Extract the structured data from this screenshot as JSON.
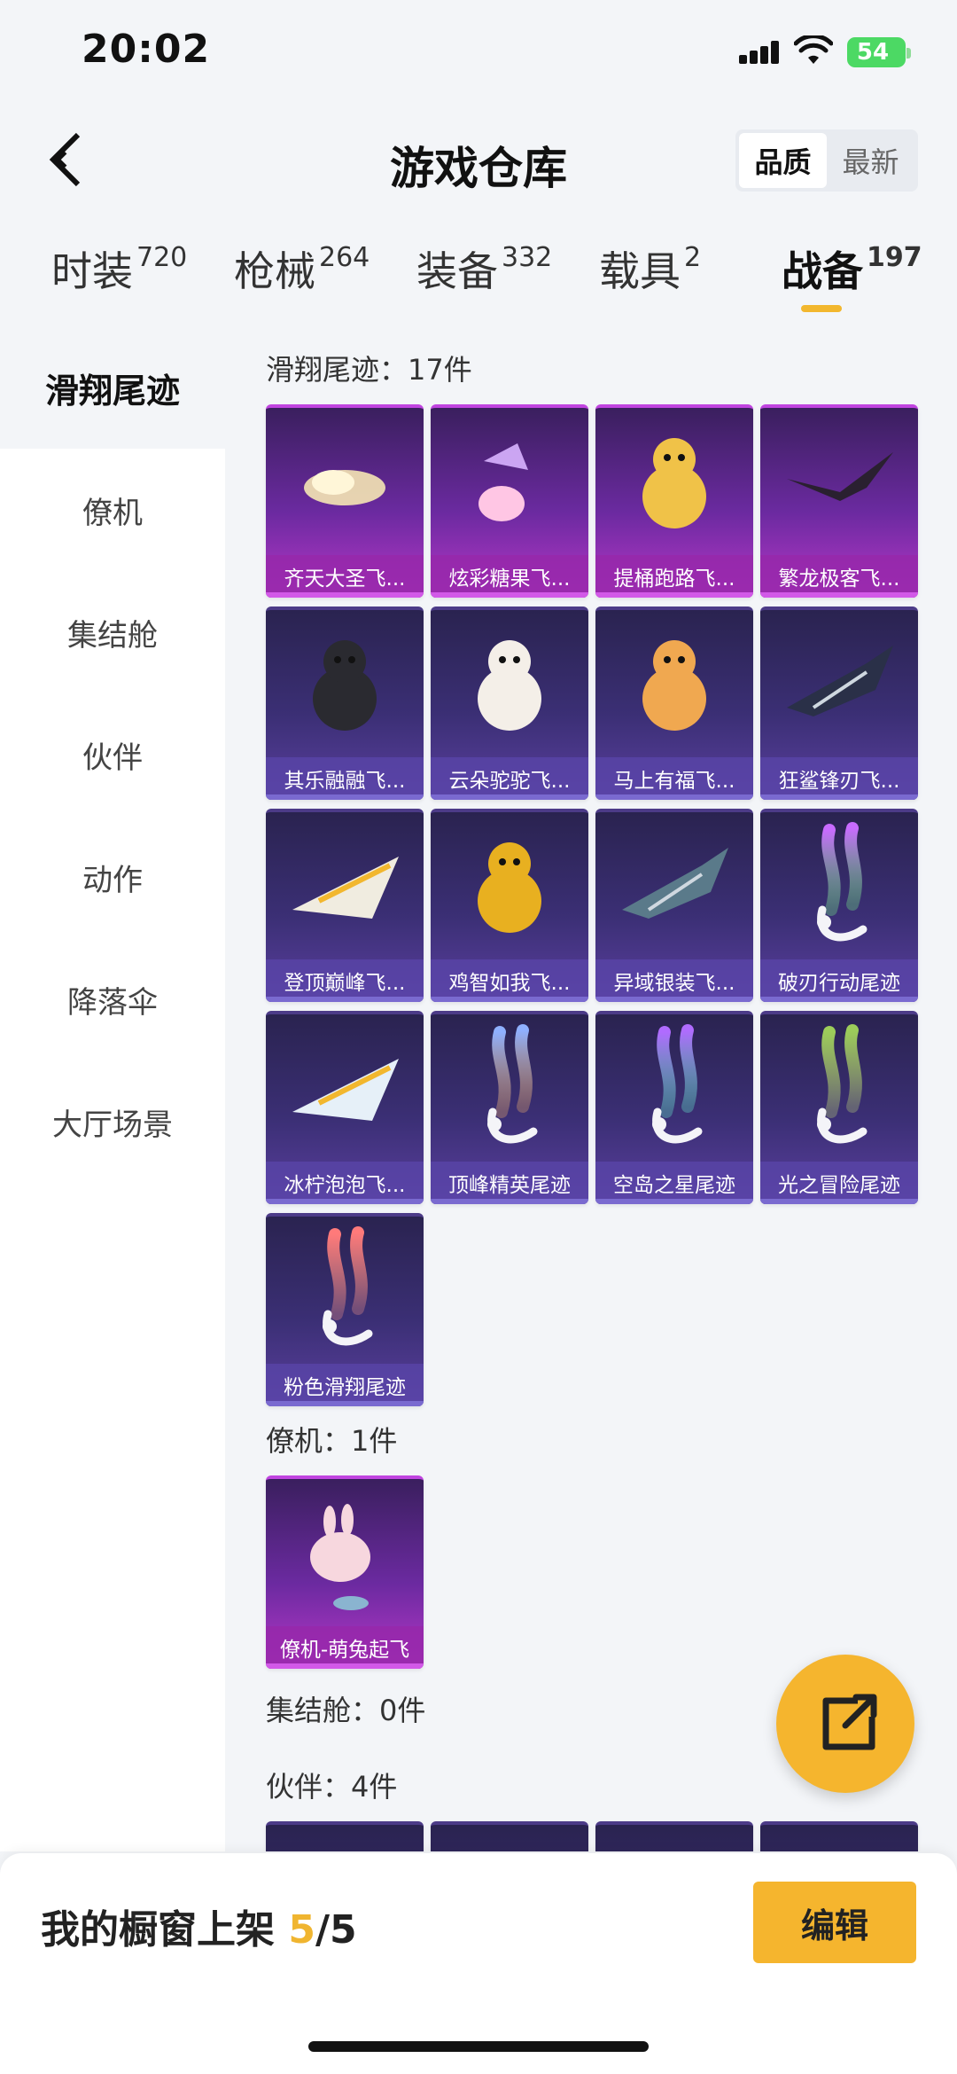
{
  "status_bar": {
    "time": "20:02",
    "battery": "54"
  },
  "header": {
    "title": "游戏仓库",
    "sort_options": [
      {
        "label": "品质",
        "active": true
      },
      {
        "label": "最新",
        "active": false
      }
    ]
  },
  "category_tabs": [
    {
      "label": "时装",
      "count": "720",
      "active": false
    },
    {
      "label": "枪械",
      "count": "264",
      "active": false
    },
    {
      "label": "装备",
      "count": "332",
      "active": false
    },
    {
      "label": "载具",
      "count": "2",
      "active": false
    },
    {
      "label": "战备",
      "count": "197",
      "active": true
    }
  ],
  "sidebar": {
    "items": [
      {
        "label": "滑翔尾迹",
        "active": true
      },
      {
        "label": "僚机",
        "active": false
      },
      {
        "label": "集结舱",
        "active": false
      },
      {
        "label": "伙伴",
        "active": false
      },
      {
        "label": "动作",
        "active": false
      },
      {
        "label": "降落伞",
        "active": false
      },
      {
        "label": "大厅场景",
        "active": false
      }
    ]
  },
  "sections": [
    {
      "title": "滑翔尾迹：17件",
      "items": [
        {
          "name": "齐天大圣飞...",
          "rarity": "legendary",
          "icon": "golden-cloud"
        },
        {
          "name": "炫彩糖果飞...",
          "rarity": "legendary",
          "icon": "candy-wings"
        },
        {
          "name": "提桶跑路飞...",
          "rarity": "legendary",
          "icon": "bee-mascot"
        },
        {
          "name": "繁龙极客飞...",
          "rarity": "legendary",
          "icon": "dragon-glider"
        },
        {
          "name": "其乐融融飞...",
          "rarity": "epic",
          "icon": "penguin-mascot"
        },
        {
          "name": "云朵驼驼飞...",
          "rarity": "epic",
          "icon": "alpaca-mascot"
        },
        {
          "name": "马上有福飞...",
          "rarity": "epic",
          "icon": "horse-mascot"
        },
        {
          "name": "狂鲨锋刃飞...",
          "rarity": "epic",
          "icon": "shark-glider"
        },
        {
          "name": "登顶巅峰飞...",
          "rarity": "epic",
          "icon": "jet-glider"
        },
        {
          "name": "鸡智如我飞...",
          "rarity": "epic",
          "icon": "chicken-mascot"
        },
        {
          "name": "异域银装飞...",
          "rarity": "epic",
          "icon": "silver-wing-glider"
        },
        {
          "name": "破刃行动尾迹",
          "rarity": "epic",
          "icon": "smoke-trail",
          "colors": [
            "#c86bff",
            "#7cff8a"
          ]
        },
        {
          "name": "冰柠泡泡飞...",
          "rarity": "epic",
          "icon": "paper-plane-glider"
        },
        {
          "name": "顶峰精英尾迹",
          "rarity": "epic",
          "icon": "smoke-trail",
          "colors": [
            "#8fb0ff",
            "#ffb86b"
          ]
        },
        {
          "name": "空岛之星尾迹",
          "rarity": "epic",
          "icon": "smoke-trail",
          "colors": [
            "#b06bff",
            "#6bffd9"
          ]
        },
        {
          "name": "光之冒险尾迹",
          "rarity": "epic",
          "icon": "smoke-trail",
          "colors": [
            "#9ccc5a",
            "#c8e07a"
          ]
        },
        {
          "name": "粉色滑翔尾迹",
          "rarity": "epic",
          "icon": "smoke-trail",
          "colors": [
            "#ff7a7a",
            "#ff9a8a"
          ]
        }
      ]
    },
    {
      "title": "僚机：1件",
      "items": [
        {
          "name": "僚机-萌兔起飞",
          "rarity": "legendary",
          "icon": "bunny-drone"
        }
      ]
    },
    {
      "title": "集结舱：0件",
      "items": []
    },
    {
      "title": "伙伴：4件",
      "items": [
        {
          "name": "",
          "rarity": "epic",
          "icon": "partner"
        },
        {
          "name": "",
          "rarity": "epic",
          "icon": "partner"
        },
        {
          "name": "",
          "rarity": "epic",
          "icon": "partner"
        },
        {
          "name": "",
          "rarity": "epic",
          "icon": "partner"
        }
      ]
    }
  ],
  "bottom_bar": {
    "label": "我的橱窗上架 ",
    "count": "5",
    "total": "/5",
    "edit_label": "编辑"
  },
  "colors": {
    "accent": "#f5b52e",
    "legendary": "#b637c7",
    "epic": "#5a3f9e"
  }
}
